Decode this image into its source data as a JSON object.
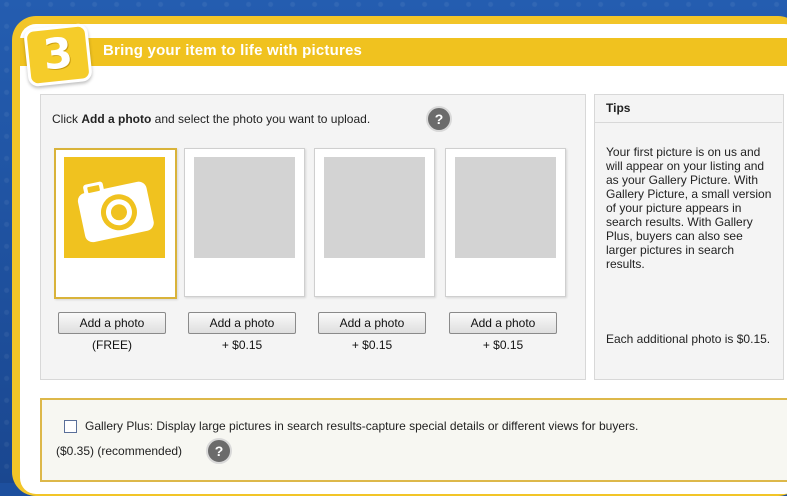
{
  "step": {
    "number": "3",
    "title": "Bring your item to life with pictures"
  },
  "instruction": {
    "prefix": "Click ",
    "bold": "Add a photo",
    "suffix": " and select the photo you want to upload."
  },
  "help_icon": "question-mark-icon",
  "photos": [
    {
      "button": "Add a photo",
      "price": "(FREE)",
      "icon": "camera-icon"
    },
    {
      "button": "Add a photo",
      "price": "+ $0.15"
    },
    {
      "button": "Add a photo",
      "price": "+ $0.15"
    },
    {
      "button": "Add a photo",
      "price": "+ $0.15"
    }
  ],
  "tips": {
    "title": "Tips",
    "body": "Your first picture is on us and will appear on your listing and as your Gallery Picture. With Gallery Picture, a small version of your picture appears in search results. With Gallery Plus, buyers can also see larger pictures in search results.",
    "extra": "Each additional photo is $0.15."
  },
  "gallery_plus": {
    "checked": false,
    "label": "Gallery Plus: Display large pictures in search results-capture special details or different views for buyers.",
    "price_note": "($0.35) (recommended)"
  },
  "colors": {
    "accent": "#f0c21f",
    "background": "#1d4f9e",
    "placeholder": "#d3d3d3"
  }
}
